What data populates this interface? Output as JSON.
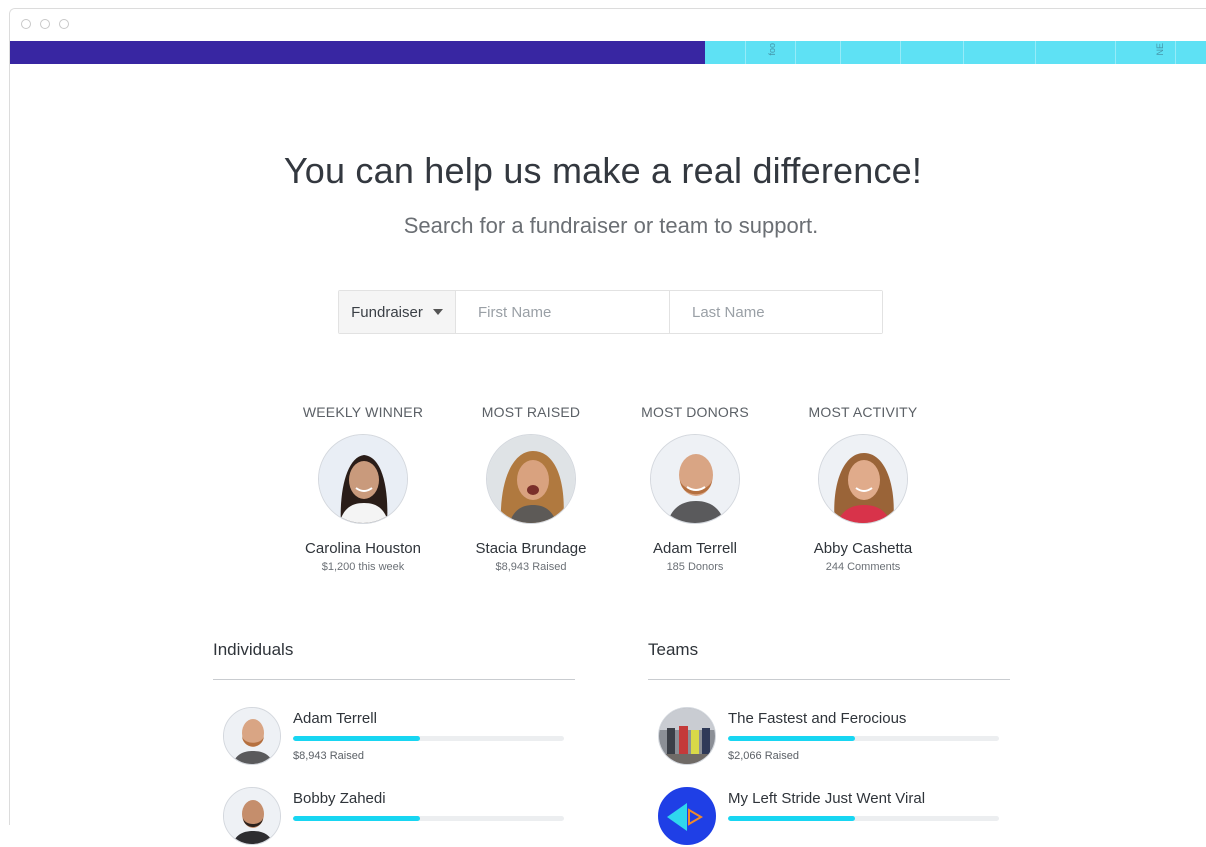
{
  "headline": "You can help us make a real difference!",
  "subhead": "Search for a fundraiser or team to support.",
  "search": {
    "type_label": "Fundraiser",
    "first_name_placeholder": "First Name",
    "last_name_placeholder": "Last Name"
  },
  "banner": {
    "map_label_1": "foo",
    "map_label_2": "NE"
  },
  "colors": {
    "banner_left": "#3826a2",
    "banner_right": "#5ee1f4",
    "progress": "#18d6f2"
  },
  "leaders": [
    {
      "category": "WEEKLY WINNER",
      "name": "Carolina Houston",
      "stat": "$1,200 this week"
    },
    {
      "category": "MOST RAISED",
      "name": "Stacia Brundage",
      "stat": "$8,943 Raised"
    },
    {
      "category": "MOST DONORS",
      "name": "Adam Terrell",
      "stat": "185 Donors"
    },
    {
      "category": "MOST ACTIVITY",
      "name": "Abby Cashetta",
      "stat": "244 Comments"
    }
  ],
  "individuals": {
    "title": "Individuals",
    "items": [
      {
        "name": "Adam Terrell",
        "raised": "$8,943 Raised",
        "progress_fraction": 0.47
      },
      {
        "name": "Bobby Zahedi",
        "raised": "",
        "progress_fraction": 0.47
      }
    ]
  },
  "teams": {
    "title": "Teams",
    "items": [
      {
        "name": "The Fastest and Ferocious",
        "raised": "$2,066 Raised",
        "progress_fraction": 0.47
      },
      {
        "name": "My Left Stride Just Went Viral",
        "raised": "",
        "progress_fraction": 0.47
      }
    ]
  }
}
